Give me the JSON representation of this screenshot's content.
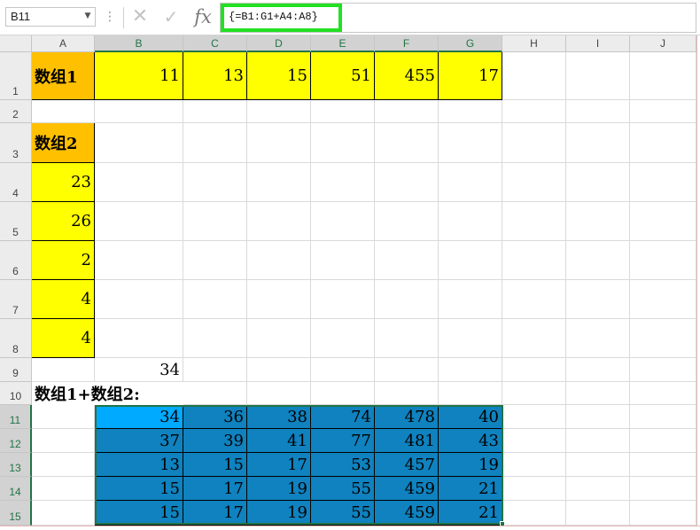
{
  "formula_bar": {
    "name_box": "B11",
    "formula": "{=B1:G1+A4:A8}",
    "cancel_glyph": "✕",
    "enter_glyph": "✓",
    "fx_label": "fx",
    "dots": "⋮",
    "dropdown_glyph": "▼"
  },
  "columns": [
    "A",
    "B",
    "C",
    "D",
    "E",
    "F",
    "G",
    "H",
    "I",
    "J"
  ],
  "rows": [
    "1",
    "2",
    "3",
    "4",
    "5",
    "6",
    "7",
    "8",
    "9",
    "10",
    "11",
    "12",
    "13",
    "14",
    "15"
  ],
  "cells": {
    "A1": "数组1",
    "B1": "11",
    "C1": "13",
    "D1": "15",
    "E1": "51",
    "F1": "455",
    "G1": "17",
    "A3": "数组2",
    "A4": "23",
    "A5": "26",
    "A6": "2",
    "A7": "4",
    "A8": "4",
    "B9": "34",
    "A10": "数组1+数组2:"
  },
  "result": [
    [
      "34",
      "36",
      "38",
      "74",
      "478",
      "40"
    ],
    [
      "37",
      "39",
      "41",
      "77",
      "481",
      "43"
    ],
    [
      "13",
      "15",
      "17",
      "53",
      "457",
      "19"
    ],
    [
      "15",
      "17",
      "19",
      "55",
      "459",
      "21"
    ],
    [
      "15",
      "17",
      "19",
      "55",
      "459",
      "21"
    ]
  ],
  "colors": {
    "label_fill": "#ffc000",
    "data_fill": "#ffff00",
    "result_fill": "#0f82bf",
    "active_cell_fill": "#00aaff",
    "selection_border": "#217346",
    "formula_highlight": "#22e022"
  },
  "selection": {
    "range": "B11:G15",
    "active_cell": "B11"
  }
}
